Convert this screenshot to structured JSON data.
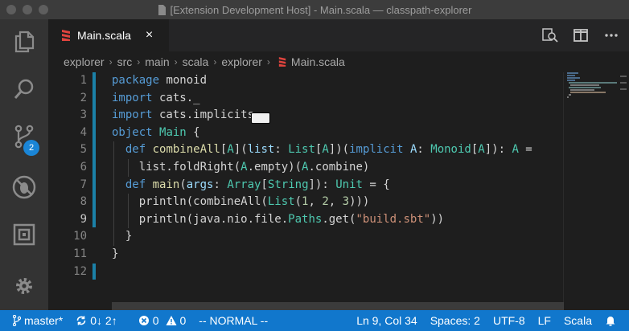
{
  "window": {
    "title": "[Extension Development Host] - Main.scala — classpath-explorer"
  },
  "activity_bar": {
    "scm_badge": "2"
  },
  "tab": {
    "label": "Main.scala",
    "close": "×"
  },
  "breadcrumb": {
    "items": [
      "explorer",
      "src",
      "main",
      "scala",
      "explorer",
      "Main.scala"
    ],
    "separator": "›"
  },
  "editor": {
    "line_numbers": [
      "1",
      "2",
      "3",
      "4",
      "5",
      "6",
      "7",
      "8",
      "9",
      "10",
      "11",
      "12"
    ],
    "active_line": 9
  },
  "statusbar": {
    "branch": "master*",
    "sync": "0↓ 2↑",
    "errors": "0",
    "warnings": "0",
    "mode": "-- NORMAL --",
    "position": "Ln 9, Col 34",
    "spaces": "Spaces: 2",
    "encoding": "UTF-8",
    "eol": "LF",
    "language": "Scala"
  },
  "colors": {
    "statusbar": "#1177cc",
    "accent": "#1a85d6",
    "scala_icon": "#e0443e"
  }
}
